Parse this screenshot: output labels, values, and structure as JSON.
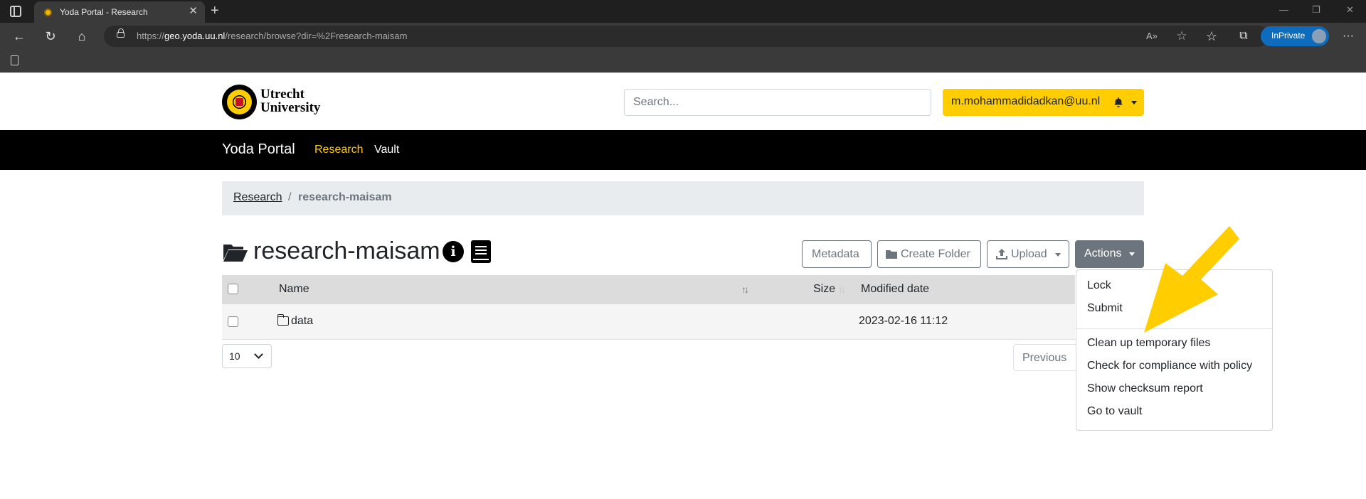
{
  "browser": {
    "tab_title": "Yoda Portal - Research",
    "url_scheme": "https://",
    "url_host": "geo.yoda.uu.nl",
    "url_path": "/research/browse?dir=%2Fresearch-maisam",
    "inprivate_label": "InPrivate"
  },
  "header": {
    "logo_line1": "Utrecht",
    "logo_line2": "University",
    "search_placeholder": "Search...",
    "user_email": "m.mohammadidadkan@uu.nl"
  },
  "navbar": {
    "brand": "Yoda Portal",
    "links": [
      {
        "label": "Research",
        "active": true
      },
      {
        "label": "Vault",
        "active": false
      }
    ]
  },
  "breadcrumb": {
    "root": "Research",
    "separator": "/",
    "current": "research-maisam"
  },
  "folder": {
    "title": "research-maisam"
  },
  "toolbar": {
    "metadata_label": "Metadata",
    "create_folder_label": "Create Folder",
    "upload_label": "Upload",
    "actions_label": "Actions"
  },
  "table": {
    "columns": [
      "Name",
      "Size",
      "Modified date"
    ],
    "rows": [
      {
        "name": "data",
        "size": "",
        "modified": "2023-02-16 11:12"
      }
    ],
    "page_size": "10",
    "previous_label": "Previous"
  },
  "actions_menu": {
    "items_group1": [
      "Lock",
      "Submit"
    ],
    "items_group2": [
      "Clean up temporary files",
      "Check for compliance with policy",
      "Show checksum report",
      "Go to vault"
    ]
  },
  "colors": {
    "accent_yellow": "#ffcd00",
    "navbar_bg": "#000000",
    "secondary": "#6c757d",
    "annotation_arrow": "#ffcd00"
  }
}
